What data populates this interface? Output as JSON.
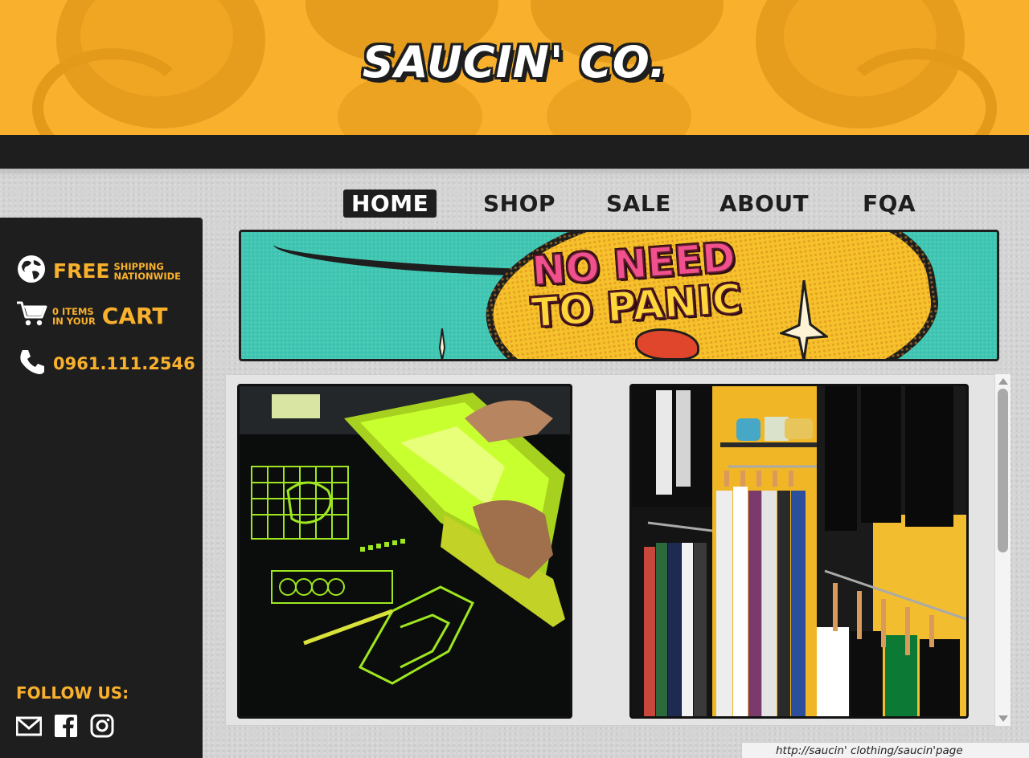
{
  "brand": {
    "logo_text": "SAUCIN' CO.",
    "primary_color": "#f9b12d",
    "dark_color": "#1e1e1e"
  },
  "nav": {
    "items": [
      {
        "label": "HOME",
        "active": true
      },
      {
        "label": "SHOP",
        "active": false
      },
      {
        "label": "SALE",
        "active": false
      },
      {
        "label": "ABOUT",
        "active": false
      },
      {
        "label": "FQA",
        "active": false
      }
    ]
  },
  "sidebar": {
    "shipping": {
      "icon": "globe-icon",
      "big": "FREE",
      "line1": "SHIPPING",
      "line2": "NATIONWIDE"
    },
    "cart": {
      "icon": "cart-icon",
      "line1": "0 ITEMS",
      "line2": "IN YOUR",
      "big": "CART"
    },
    "phone": {
      "icon": "phone-icon",
      "number": "0961.111.2546"
    },
    "follow_label": "FOLLOW US:",
    "social": [
      "mail-icon",
      "facebook-icon",
      "instagram-icon"
    ]
  },
  "banner": {
    "line1": "NO NEED",
    "line2": "TO PANIC"
  },
  "gallery": [
    {
      "name": "screen-printing-photo",
      "alt": "screen printing"
    },
    {
      "name": "store-rack-photo",
      "alt": "clothing rack"
    }
  ],
  "status": {
    "url": "http://saucin' clothing/saucin'page"
  }
}
